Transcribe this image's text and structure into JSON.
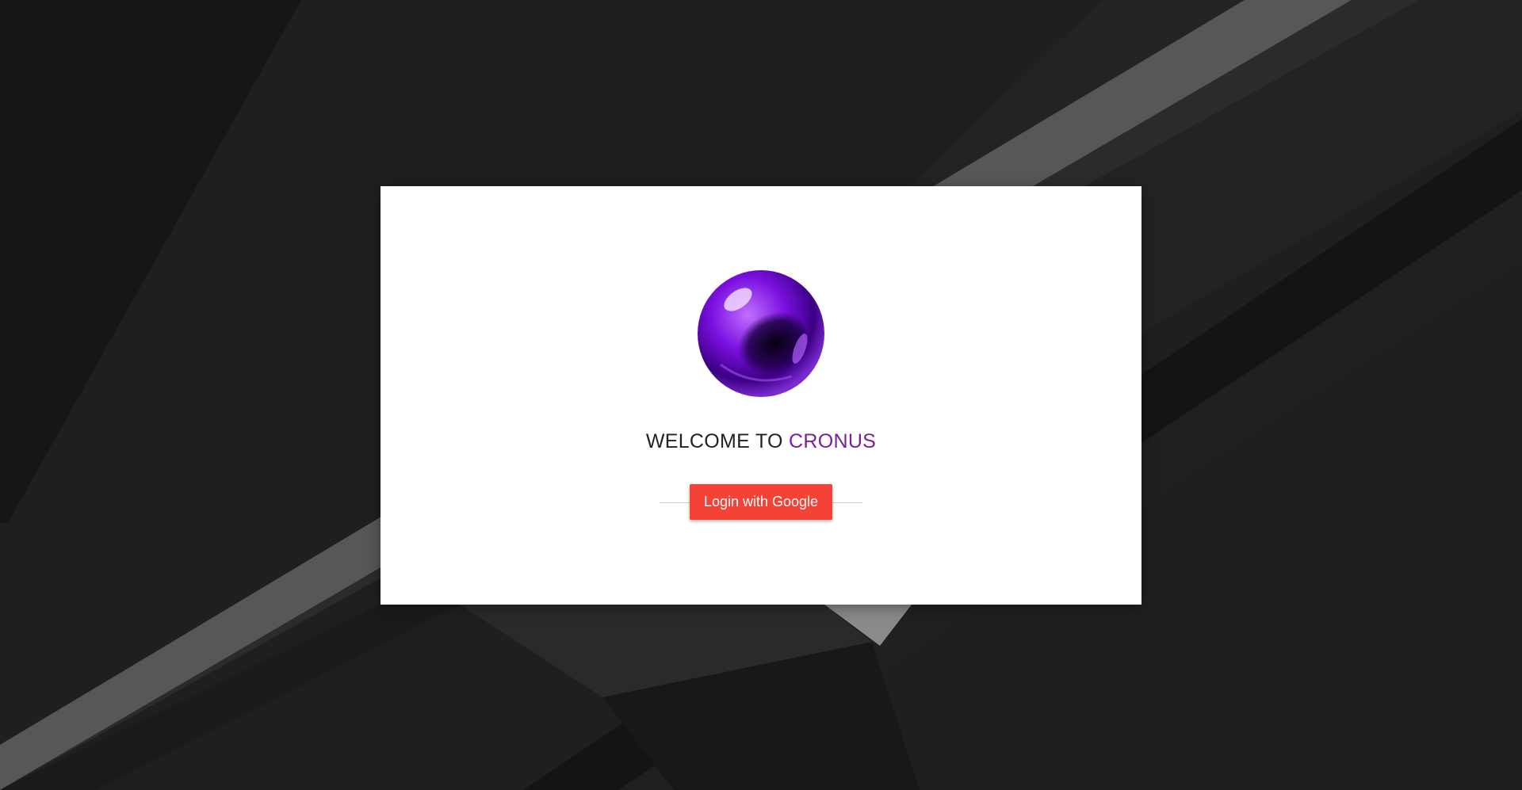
{
  "theme": {
    "background": "#1f1f1f",
    "card_background": "#ffffff",
    "brand_color": "#7b1fa2",
    "button_color": "#f44336"
  },
  "login": {
    "logo_icon": "purple-orb-icon",
    "welcome_prefix": "WELCOME TO",
    "brand_name": "CRONUS",
    "google_button_label": "Login with Google"
  }
}
